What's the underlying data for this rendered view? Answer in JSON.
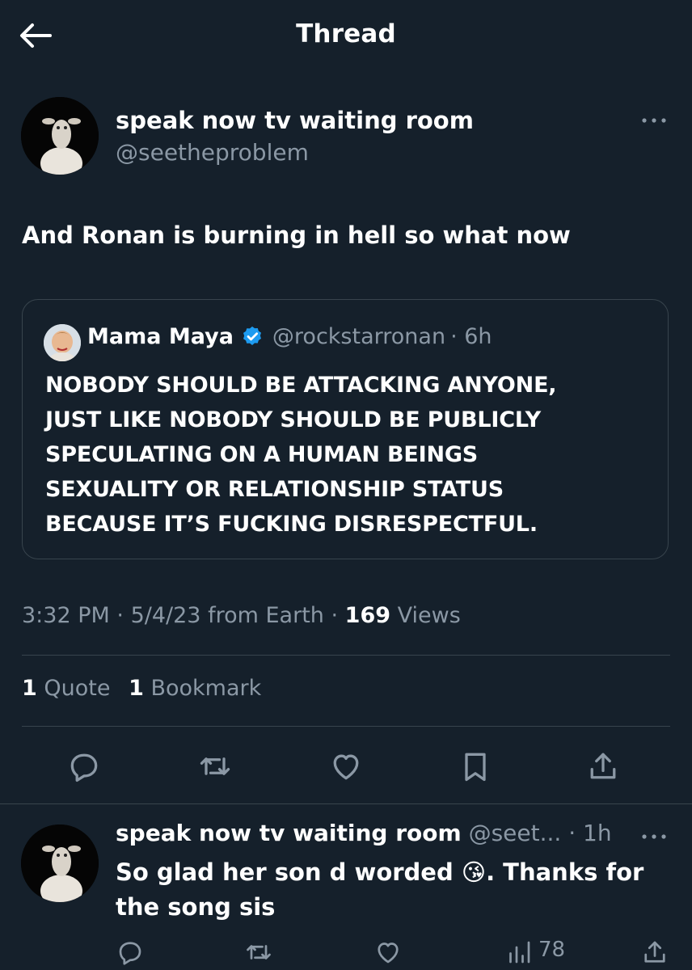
{
  "header": {
    "title": "Thread"
  },
  "tweet": {
    "display_name": "speak now tv waiting room",
    "handle": "@seetheproblem",
    "text": "And Ronan is burning in hell so what now",
    "quote": {
      "display_name": "Mama Maya",
      "handle": "@rockstarronan",
      "time": "· 6h",
      "verified": true,
      "lines": [
        "NOBODY SHOULD BE ATTACKING ANYONE,",
        "JUST LIKE NOBODY SHOULD BE PUBLICLY",
        "SPECULATING ON A HUMAN BEINGS",
        "SEXUALITY OR RELATIONSHIP STATUS",
        "BECAUSE IT’S FUCKING DISRESPECTFUL."
      ]
    },
    "meta": {
      "time": "3:32 PM",
      "sep1": "·",
      "date_source": "5/4/23 from Earth",
      "sep2": "·",
      "views_count": "169",
      "views_label": "Views"
    },
    "stats": {
      "quotes_count": "1",
      "quotes_label": "Quote",
      "bookmarks_count": "1",
      "bookmarks_label": "Bookmark"
    }
  },
  "reply": {
    "display_name": "speak now tv waiting room",
    "handle": "@seet...",
    "time": "· 1h",
    "text_before": "So glad her son d worded ",
    "emoji": "😘",
    "text_after": ". Thanks for the song sis",
    "views": "78"
  },
  "icons": [
    "back-arrow-icon",
    "more-icon",
    "verified-badge-icon",
    "reply-icon",
    "retweet-icon",
    "like-icon",
    "bookmark-icon",
    "share-icon",
    "views-icon"
  ],
  "colors": {
    "background": "#15202b",
    "muted": "#8b98a5",
    "divider": "#38444d",
    "verified": "#1d9bf0"
  }
}
